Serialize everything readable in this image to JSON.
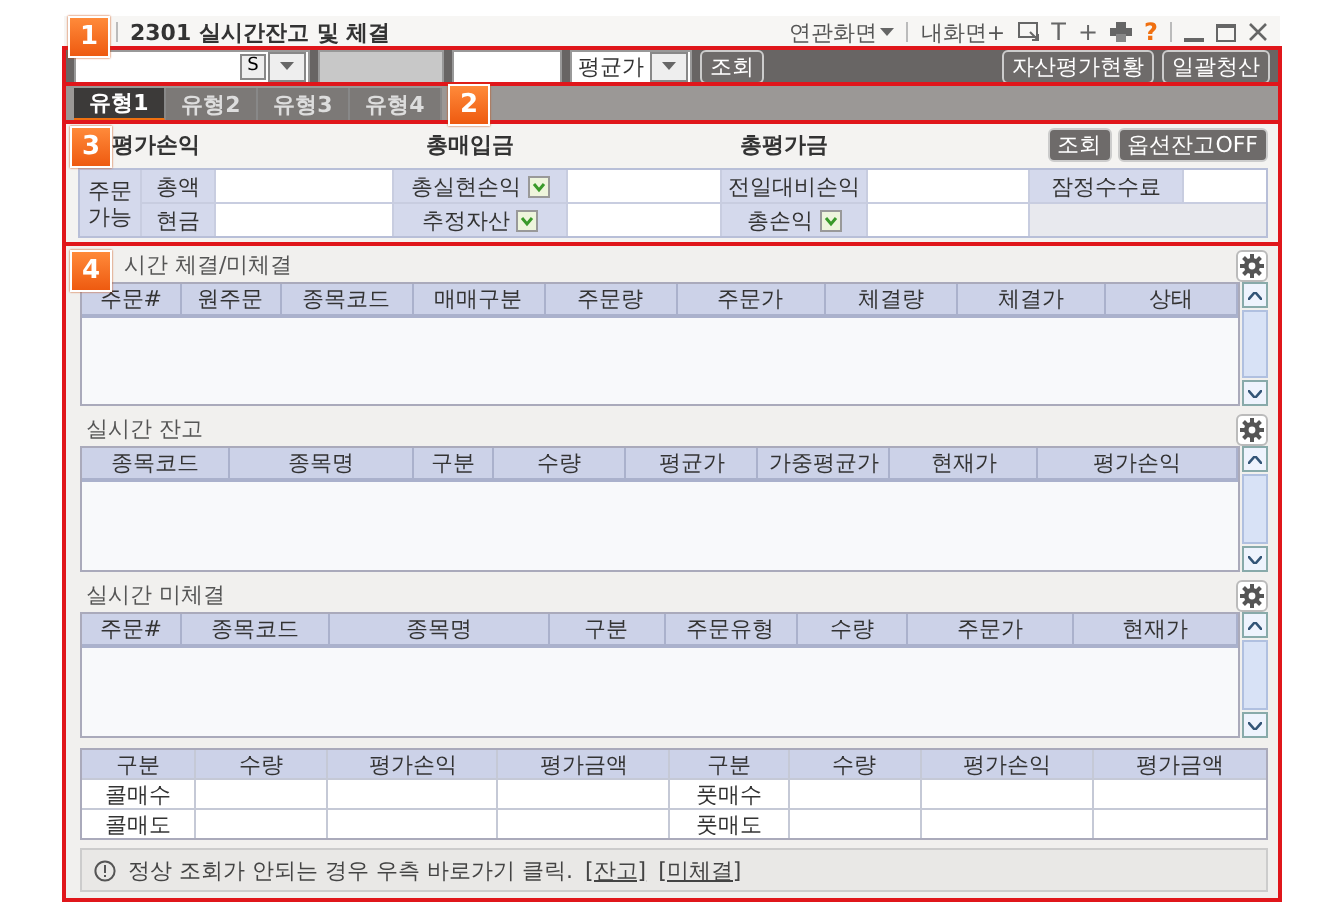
{
  "title_bar": {
    "marker": "1",
    "code": "2301",
    "title": "실시간잔고 및 체결",
    "links": [
      {
        "label": "연관화면",
        "kind": "menu"
      },
      {
        "label": "내화면+",
        "kind": "plain"
      }
    ],
    "tools": [
      {
        "kind": "popout"
      },
      {
        "kind": "glyph",
        "label": "T"
      },
      {
        "kind": "glyph",
        "label": "+"
      },
      {
        "kind": "printer"
      },
      {
        "kind": "help",
        "label": "?"
      }
    ]
  },
  "toolbar": {
    "account_button": "S",
    "price_select": "평균가",
    "query_button": "조회",
    "right_buttons": [
      "자산평가현황",
      "일괄청산"
    ]
  },
  "tabs": {
    "marker": "2",
    "items": [
      {
        "label": "유형1",
        "selected": true
      },
      {
        "label": "유형2",
        "selected": false
      },
      {
        "label": "유형3",
        "selected": false
      },
      {
        "label": "유형4",
        "selected": false
      }
    ]
  },
  "summary": {
    "marker": "3",
    "totals": [
      "평가손익",
      "총매입금",
      "총평가금"
    ],
    "buttons": [
      "조회",
      "옵션잔고OFF"
    ],
    "order_label": [
      "주문",
      "가능"
    ],
    "rows": [
      [
        {
          "label": "총액",
          "dropdown": false
        },
        {
          "label": "총실현손익",
          "dropdown": true
        },
        {
          "label": "전일대비손익",
          "dropdown": false
        },
        {
          "label": "잠정수수료",
          "dropdown": false
        }
      ],
      [
        {
          "label": "현금",
          "dropdown": false
        },
        {
          "label": "추정자산",
          "dropdown": true
        },
        {
          "label": "총손익",
          "dropdown": true
        }
      ]
    ]
  },
  "panels": {
    "marker": "4",
    "grids": [
      {
        "title": "시간 체결/미체결",
        "columns": [
          "주문#",
          "원주문",
          "종목코드",
          "매매구분",
          "주문량",
          "주문가",
          "체결량",
          "체결가",
          "상태"
        ]
      },
      {
        "title": "실시간 잔고",
        "columns": [
          "종목코드",
          "종목명",
          "구분",
          "수량",
          "평균가",
          "가중평균가",
          "현재가",
          "평가손익"
        ]
      },
      {
        "title": "실시간 미체결",
        "columns": [
          "주문#",
          "종목코드",
          "종목명",
          "구분",
          "주문유형",
          "수량",
          "주문가",
          "현재가"
        ]
      }
    ]
  },
  "position_summary": {
    "columns": [
      "구분",
      "수량",
      "평가손익",
      "평가금액",
      "구분",
      "수량",
      "평가손익",
      "평가금액"
    ],
    "rows": [
      {
        "left": "콜매수",
        "right": "풋매수"
      },
      {
        "left": "콜매도",
        "right": "풋매도"
      }
    ]
  },
  "notice": {
    "text": "정상 조회가 안되는 경우 우측 바로가기 클릭.",
    "links": [
      "[잔고]",
      "[미체결]"
    ]
  }
}
